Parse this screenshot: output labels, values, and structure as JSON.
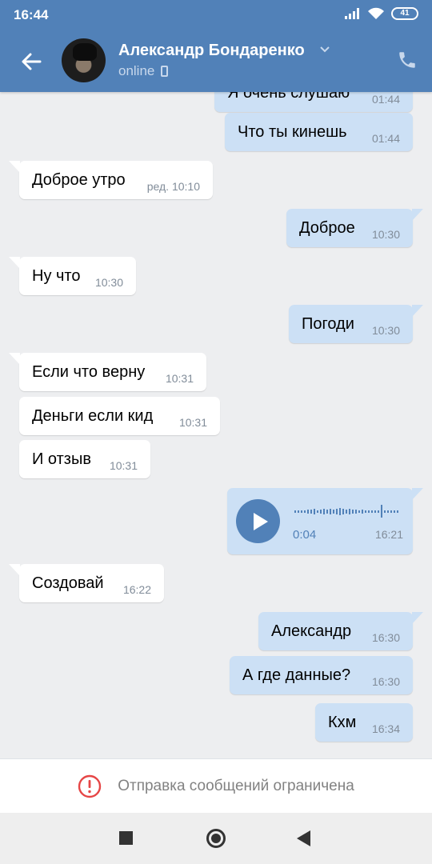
{
  "status_bar": {
    "time": "16:44",
    "battery": "41"
  },
  "header": {
    "contact_name": "Александр Бондаренко",
    "status": "online"
  },
  "messages": [
    {
      "dir": "out",
      "text": "Я очень слушаю",
      "time": "01:44"
    },
    {
      "dir": "out",
      "text": "Что ты кинешь",
      "time": "01:44"
    },
    {
      "dir": "in",
      "text": "Доброе утро",
      "time": "ред. 10:10"
    },
    {
      "dir": "out",
      "text": "Доброе",
      "time": "10:30"
    },
    {
      "dir": "in",
      "text": "Ну что",
      "time": "10:30"
    },
    {
      "dir": "out",
      "text": "Погоди",
      "time": "10:30"
    },
    {
      "dir": "in",
      "text": "Если что верну",
      "time": "10:31"
    },
    {
      "dir": "in",
      "text": "Деньги если кид",
      "time": "10:31"
    },
    {
      "dir": "in",
      "text": "И отзыв",
      "time": "10:31"
    },
    {
      "dir": "in",
      "text": "Создовай",
      "time": "16:22"
    },
    {
      "dir": "out",
      "text": "Александр",
      "time": "16:30"
    },
    {
      "dir": "out",
      "text": "А где данные?",
      "time": "16:30"
    },
    {
      "dir": "out",
      "text": "Кхм",
      "time": "16:34"
    }
  ],
  "voice_message": {
    "duration": "0:04",
    "time": "16:21",
    "progress": 0.0
  },
  "footer": {
    "restricted_text": "Отправка сообщений ограничена"
  },
  "colors": {
    "header": "#5181b8",
    "outgoing": "#cce0f5",
    "incoming": "#ffffff",
    "background": "#edeef0",
    "alert": "#e64646"
  },
  "icons": [
    "back-arrow-icon",
    "chevron-down-icon",
    "mobile-phone-icon",
    "phone-call-icon",
    "play-icon",
    "alert-icon",
    "signal-icon",
    "wifi-icon",
    "battery-icon"
  ]
}
